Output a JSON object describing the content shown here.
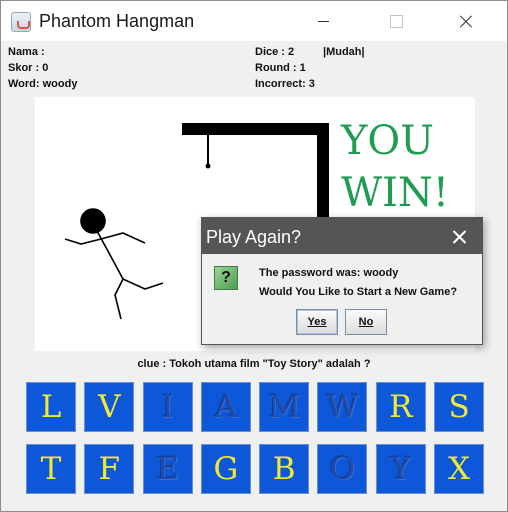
{
  "window": {
    "title": "Phantom Hangman"
  },
  "info": {
    "nama": "Nama :",
    "skor": "Skor : 0",
    "word": "Word: woody",
    "dice": "Dice : 2",
    "level": "|Mudah|",
    "round": "Round : 1",
    "incorrect": "Incorrect: 3"
  },
  "banner": {
    "line1": "YOU",
    "line2": "WIN!"
  },
  "clue": "clue : Tokoh utama film \"Toy Story\" adalah ?",
  "letters": [
    {
      "ch": "L",
      "active": true
    },
    {
      "ch": "V",
      "active": true
    },
    {
      "ch": "I",
      "active": false
    },
    {
      "ch": "A",
      "active": false
    },
    {
      "ch": "M",
      "active": false
    },
    {
      "ch": "W",
      "active": false
    },
    {
      "ch": "R",
      "active": true
    },
    {
      "ch": "S",
      "active": true
    },
    {
      "ch": "T",
      "active": true
    },
    {
      "ch": "F",
      "active": true
    },
    {
      "ch": "E",
      "active": false
    },
    {
      "ch": "G",
      "active": true
    },
    {
      "ch": "B",
      "active": true
    },
    {
      "ch": "O",
      "active": false
    },
    {
      "ch": "Y",
      "active": false
    },
    {
      "ch": "X",
      "active": true
    }
  ],
  "dialog": {
    "title": "Play Again?",
    "icon_char": "?",
    "message1": "The password was: woody",
    "message2": "Would You Like to Start a New Game?",
    "yes": "Yes",
    "no": "No"
  },
  "colors": {
    "key_bg": "#0d58d8",
    "key_text": "#f2e83a",
    "win_text": "#1f9b52",
    "dialog_title_bg": "#555555"
  }
}
